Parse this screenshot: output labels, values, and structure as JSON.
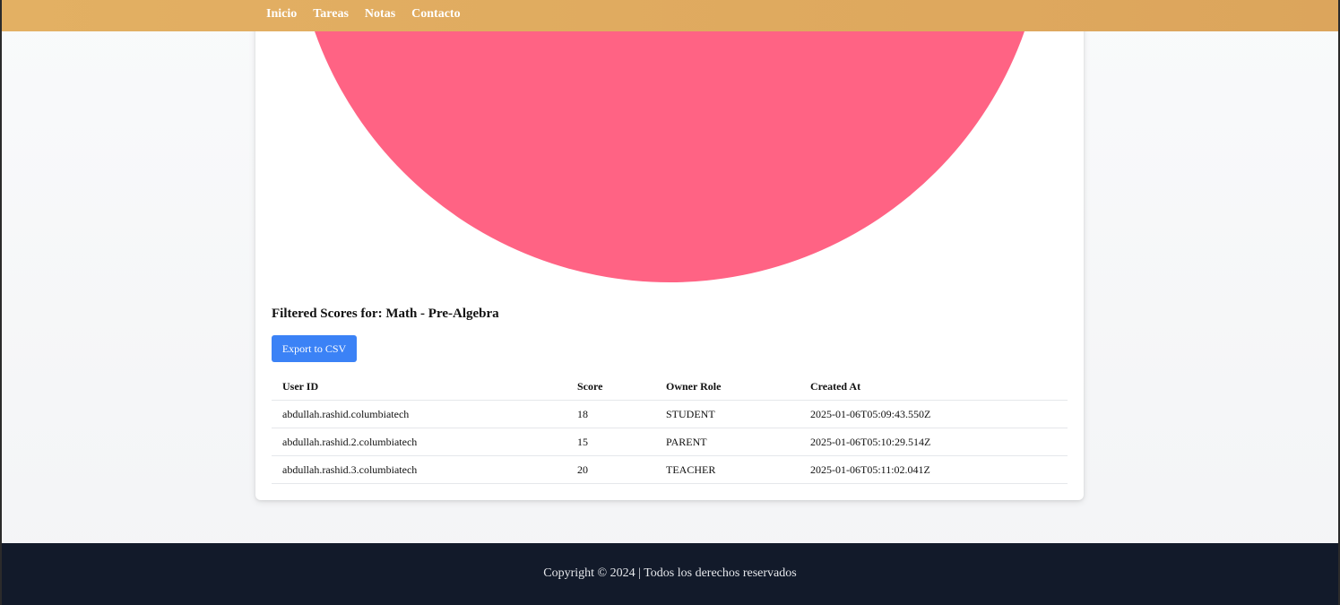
{
  "nav": {
    "links": [
      "Inicio",
      "Tareas",
      "Notas",
      "Contacto"
    ]
  },
  "chart_data": {
    "type": "pie",
    "categories": [
      "abdullah.rashid.3.columbiatech"
    ],
    "values": [
      20
    ],
    "colors": [
      "#ff6384"
    ],
    "title": "",
    "legend": "none"
  },
  "scores": {
    "title": "Filtered Scores for: Math - Pre-Algebra",
    "export_label": "Export to CSV",
    "headers": [
      "User ID",
      "Score",
      "Owner Role",
      "Created At"
    ],
    "rows": [
      [
        "abdullah.rashid.columbiatech",
        "18",
        "STUDENT",
        "2025-01-06T05:09:43.550Z"
      ],
      [
        "abdullah.rashid.2.columbiatech",
        "15",
        "PARENT",
        "2025-01-06T05:10:29.514Z"
      ],
      [
        "abdullah.rashid.3.columbiatech",
        "20",
        "TEACHER",
        "2025-01-06T05:11:02.041Z"
      ]
    ]
  },
  "footer": {
    "text": "Copyright © 2024 | Todos los derechos reservados"
  }
}
